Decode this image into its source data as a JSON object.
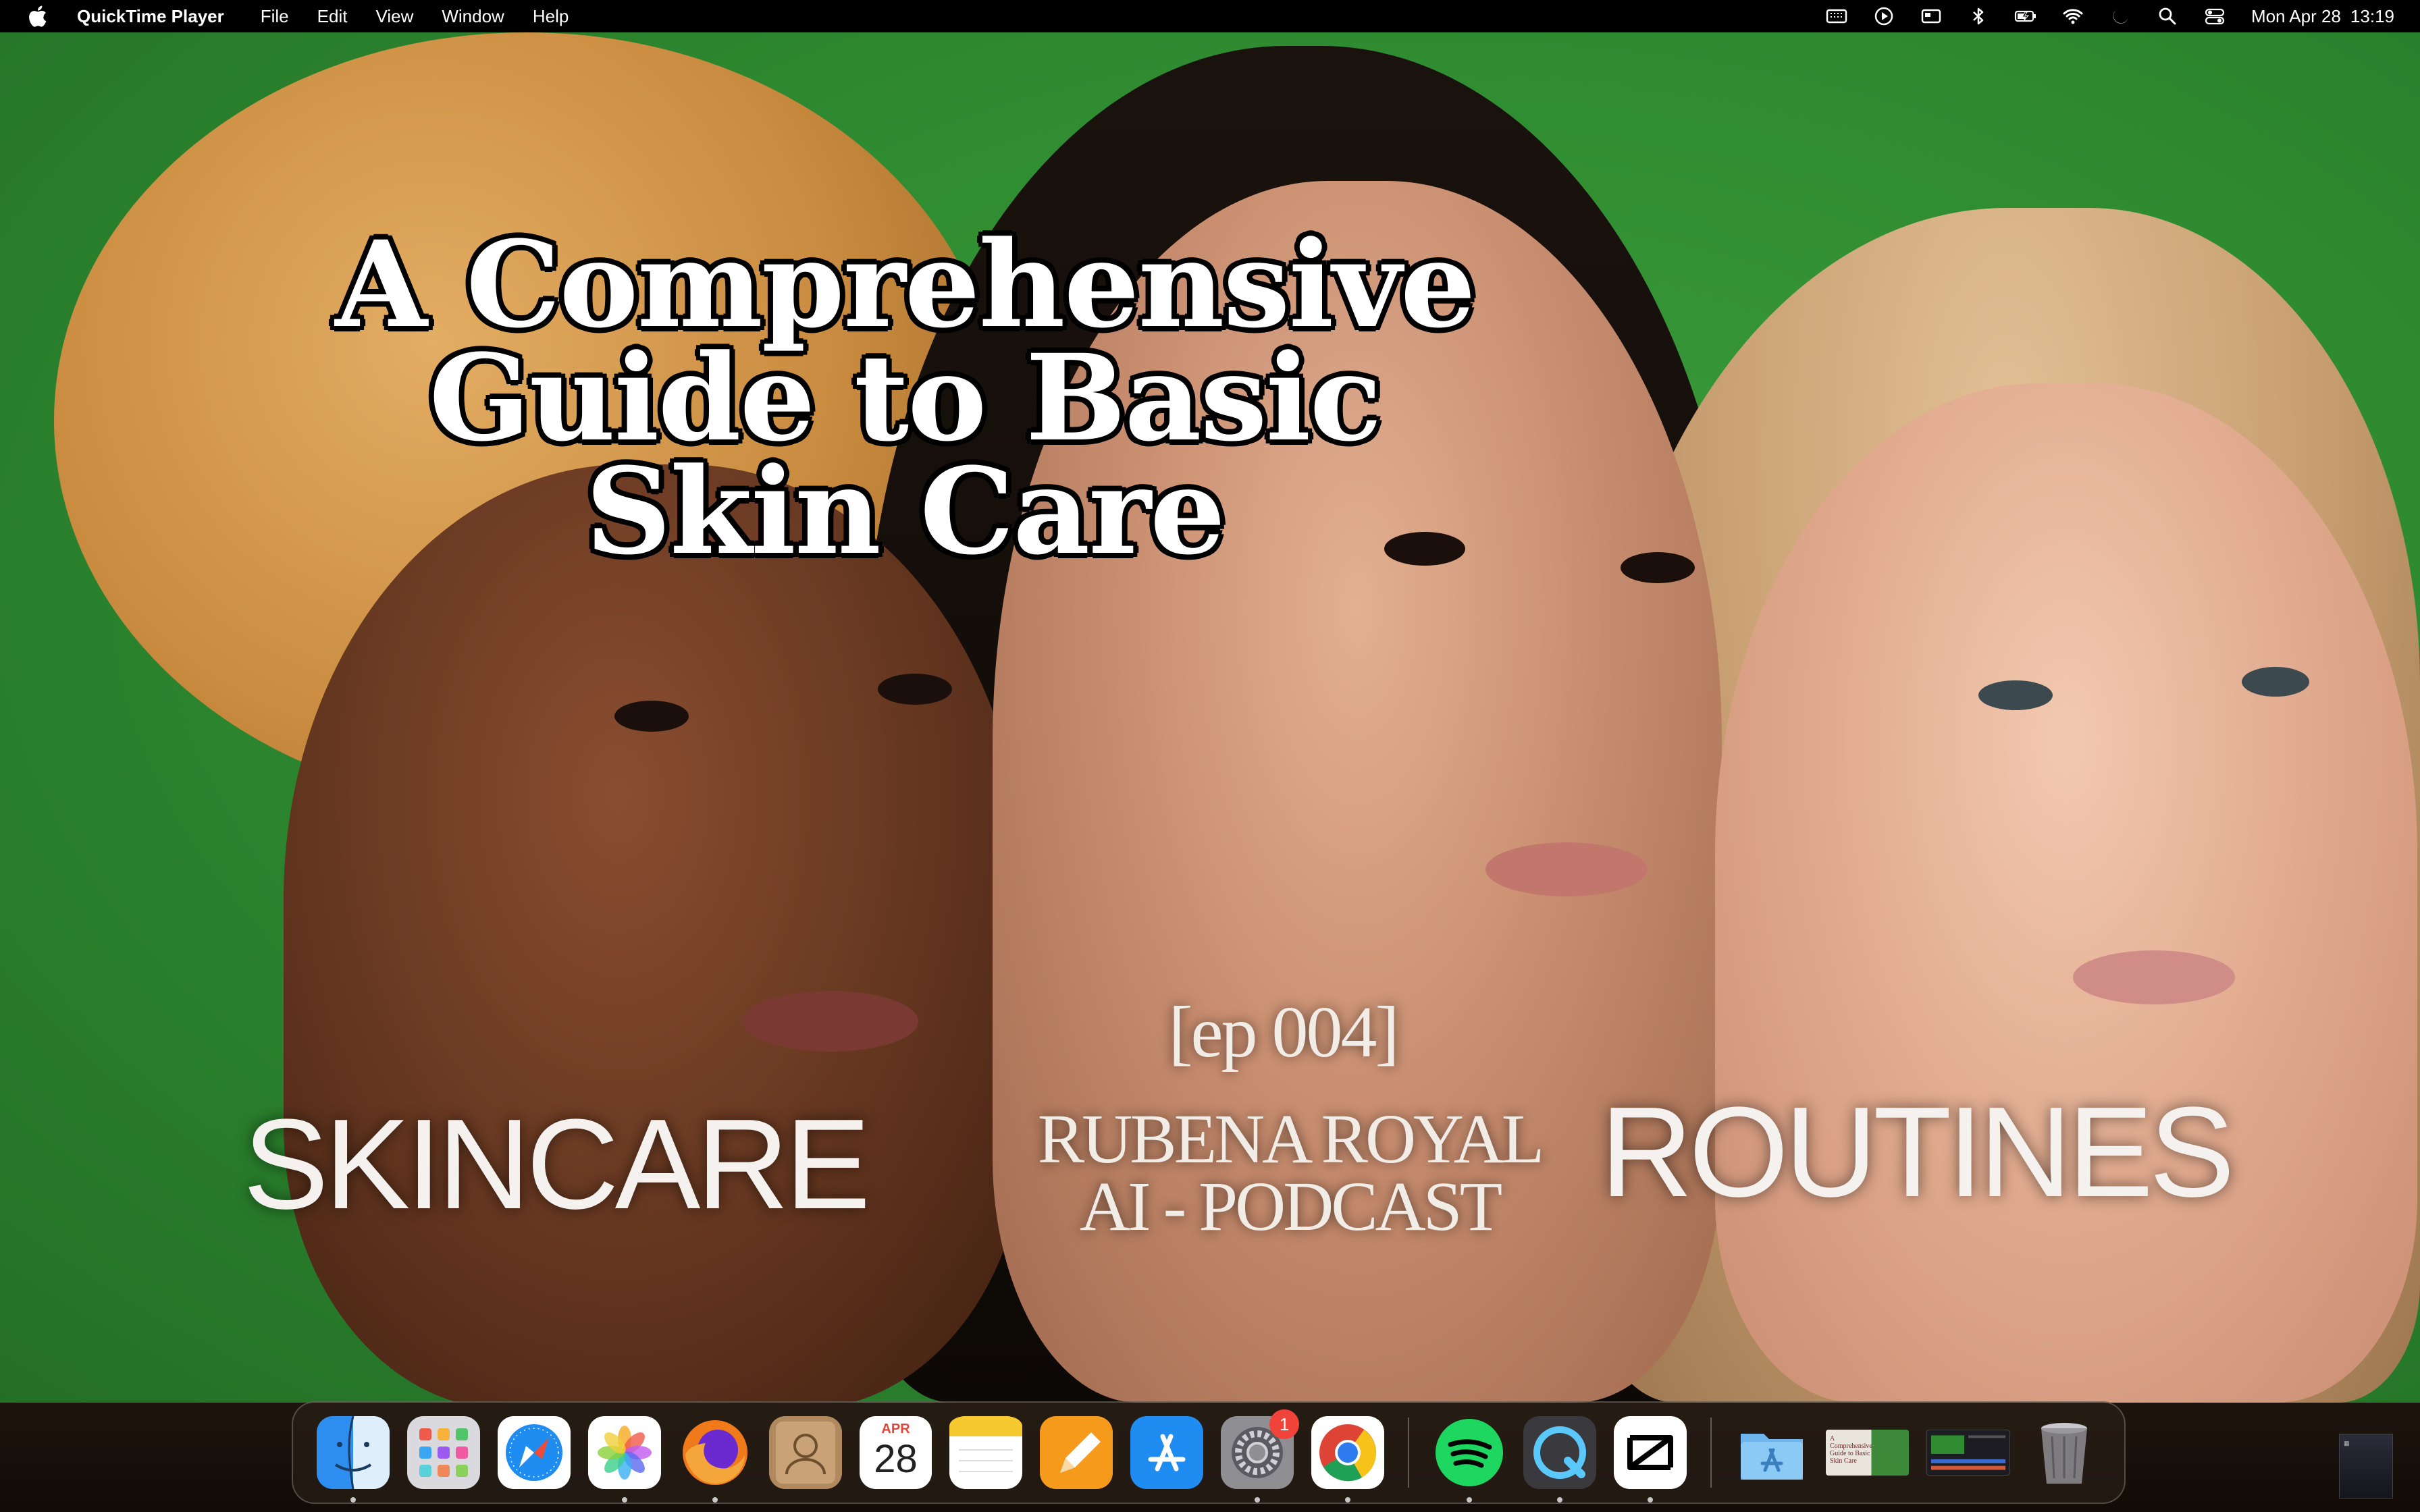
{
  "menubar": {
    "app_name": "QuickTime Player",
    "menus": [
      "File",
      "Edit",
      "View",
      "Window",
      "Help"
    ],
    "status_icons": [
      "keyboard-brightness-icon",
      "play-circle-icon",
      "window-icon",
      "bluetooth-icon",
      "battery-charging-icon",
      "wifi-icon",
      "focus-moon-icon",
      "spotlight-search-icon",
      "control-center-icon"
    ],
    "date": "Mon Apr 28",
    "time": "13:19"
  },
  "video": {
    "headline_lines": [
      "A Comprehensive",
      "Guide to Basic",
      "Skin Care"
    ],
    "episode": "[ep 004]",
    "podcast_lines": [
      "RUBENA ROYAL",
      "AI - PODCAST"
    ],
    "left_word": "SKINCARE",
    "right_word": "ROUTINES"
  },
  "dock": {
    "apps": [
      {
        "name": "Finder",
        "icon": "finder-icon"
      },
      {
        "name": "Launchpad",
        "icon": "launchpad-icon"
      },
      {
        "name": "Safari",
        "icon": "safari-icon"
      },
      {
        "name": "Photos",
        "icon": "photos-icon"
      },
      {
        "name": "Firefox",
        "icon": "firefox-icon"
      },
      {
        "name": "Contacts",
        "icon": "contacts-icon"
      },
      {
        "name": "Calendar",
        "icon": "calendar-icon",
        "month": "APR",
        "day": "28"
      },
      {
        "name": "Notes",
        "icon": "notes-icon"
      },
      {
        "name": "Pages",
        "icon": "pages-icon"
      },
      {
        "name": "App Store",
        "icon": "app-store-icon"
      },
      {
        "name": "System Settings",
        "icon": "system-settings-icon",
        "badge": "1"
      },
      {
        "name": "Chrome",
        "icon": "chrome-icon"
      },
      {
        "name": "Spotify",
        "icon": "spotify-icon"
      },
      {
        "name": "QuickTime Player",
        "icon": "quicktime-icon"
      },
      {
        "name": "CapCut",
        "icon": "capcut-icon"
      },
      {
        "name": "Applications",
        "icon": "applications-folder-icon"
      },
      {
        "name": "A Comprehensive Guide to Basic Skin Care",
        "icon": "video-thumbnail-icon"
      },
      {
        "name": "CapCut project",
        "icon": "capcut-window-icon"
      },
      {
        "name": "Trash",
        "icon": "trash-icon"
      }
    ]
  },
  "colors": {
    "menubar_bg": "#000000",
    "video_green": "#2f8c31",
    "badge_red": "#f0433a"
  }
}
